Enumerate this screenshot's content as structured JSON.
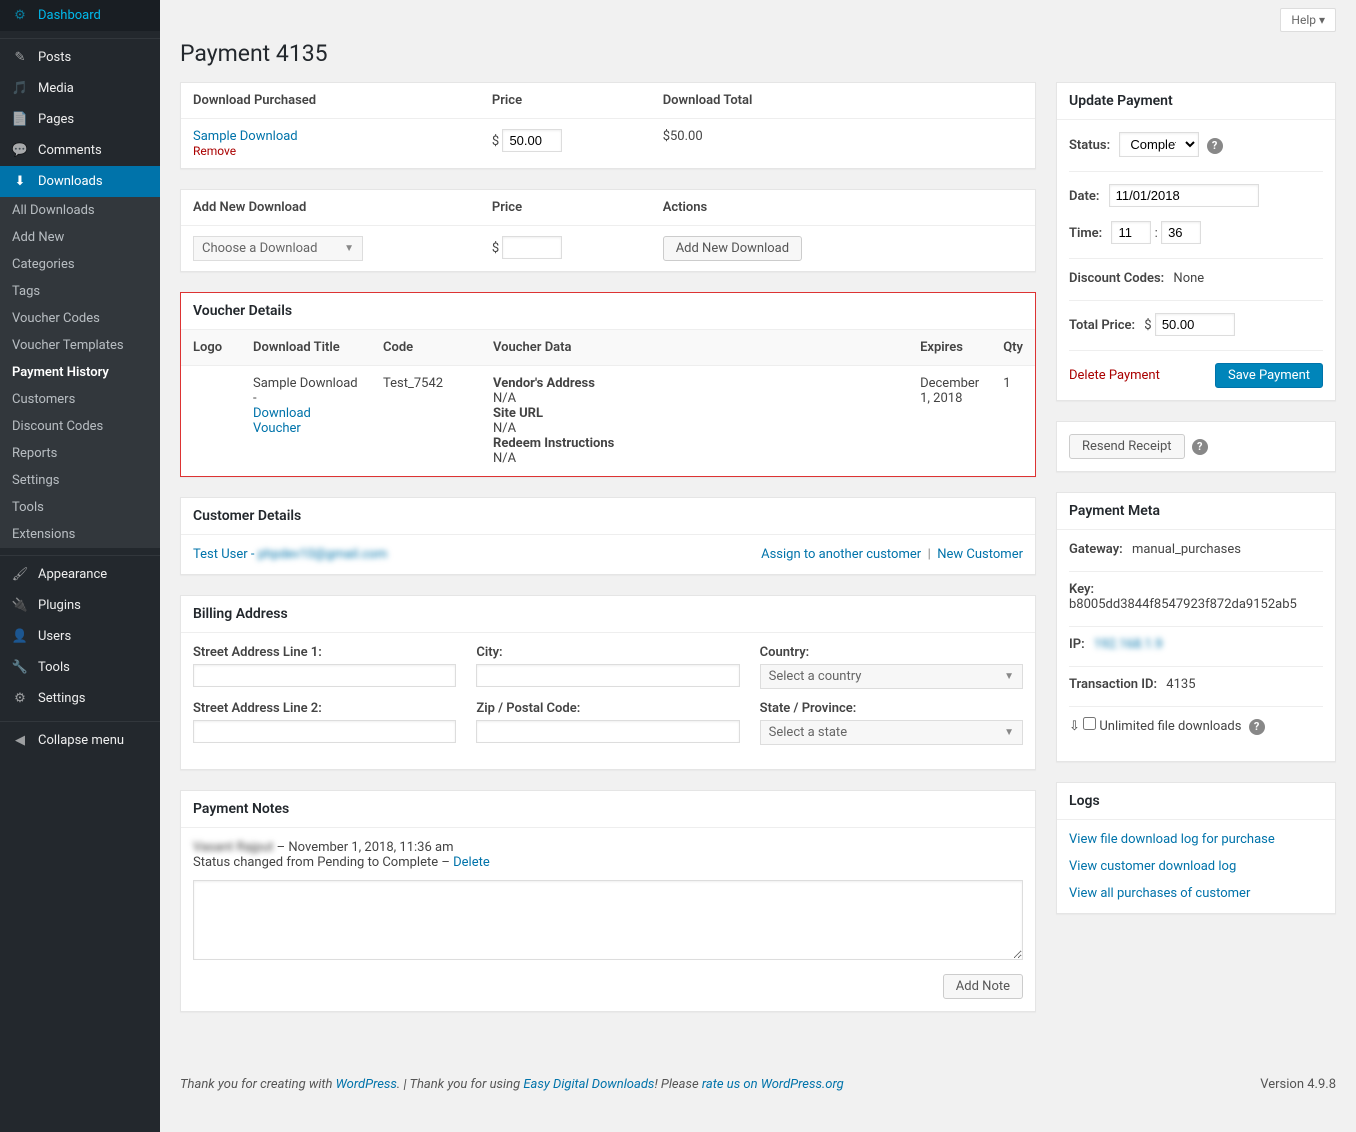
{
  "topbar": {
    "help": "Help"
  },
  "page_title": "Payment 4135",
  "sidebar": {
    "main": [
      {
        "icon": "⚙",
        "label": "Dashboard"
      },
      {
        "icon": "✎",
        "label": "Posts"
      },
      {
        "icon": "🎵",
        "label": "Media"
      },
      {
        "icon": "📄",
        "label": "Pages"
      },
      {
        "icon": "💬",
        "label": "Comments"
      }
    ],
    "downloads_label": "Downloads",
    "downloads_icon": "⬇",
    "submenu": [
      "All Downloads",
      "Add New",
      "Categories",
      "Tags",
      "Voucher Codes",
      "Voucher Templates",
      "Payment History",
      "Customers",
      "Discount Codes",
      "Reports",
      "Settings",
      "Tools",
      "Extensions"
    ],
    "bottom": [
      {
        "icon": "🖌",
        "label": "Appearance"
      },
      {
        "icon": "🔌",
        "label": "Plugins"
      },
      {
        "icon": "👤",
        "label": "Users"
      },
      {
        "icon": "🔧",
        "label": "Tools"
      },
      {
        "icon": "⚙",
        "label": "Settings"
      }
    ],
    "collapse": "Collapse menu"
  },
  "purchased": {
    "headers": [
      "Download Purchased",
      "Price",
      "Download Total"
    ],
    "item_name": "Sample Download",
    "remove": "Remove",
    "price_value": "50.00",
    "total": "$50.00"
  },
  "add_download": {
    "headers": [
      "Add New Download",
      "Price",
      "Actions"
    ],
    "choose_placeholder": "Choose a Download",
    "add_button": "Add New Download"
  },
  "voucher": {
    "title": "Voucher Details",
    "headers": [
      "Logo",
      "Download Title",
      "Code",
      "Voucher Data",
      "Expires",
      "Qty"
    ],
    "download_title_prefix": "Sample Download -",
    "download_voucher_link": "Download Voucher",
    "code": "Test_7542",
    "vendor_label": "Vendor's Address",
    "vendor_value": "N/A",
    "site_label": "Site URL",
    "site_value": "N/A",
    "redeem_label": "Redeem Instructions",
    "redeem_value": "N/A",
    "expires": "December 1, 2018",
    "qty": "1"
  },
  "customer": {
    "title": "Customer Details",
    "user_name": "Test User - ",
    "user_email": "phpdev10@gmail.com",
    "assign": "Assign to another customer",
    "new": "New Customer"
  },
  "billing": {
    "title": "Billing Address",
    "street1": "Street Address Line 1:",
    "street2": "Street Address Line 2:",
    "city": "City:",
    "zip": "Zip / Postal Code:",
    "country": "Country:",
    "country_placeholder": "Select a country",
    "state": "State / Province:",
    "state_placeholder": "Select a state"
  },
  "notes": {
    "title": "Payment Notes",
    "author": "Vasant Rajput",
    "meta": " – November 1, 2018, 11:36 am",
    "text": "Status changed from Pending to Complete – ",
    "delete": "Delete",
    "add_button": "Add Note"
  },
  "update": {
    "title": "Update Payment",
    "status_label": "Status:",
    "status_value": "Complete",
    "date_label": "Date:",
    "date_value": "11/01/2018",
    "time_label": "Time:",
    "time_h": "11",
    "time_m": "36",
    "discount_label": "Discount Codes:",
    "discount_value": "None",
    "total_label": "Total Price:",
    "total_value": "50.00",
    "delete": "Delete Payment",
    "save": "Save Payment",
    "resend": "Resend Receipt"
  },
  "meta": {
    "title": "Payment Meta",
    "gateway_label": "Gateway:",
    "gateway_value": "manual_purchases",
    "key_label": "Key:",
    "key_value": "b8005dd3844f8547923f872da9152ab5",
    "ip_label": "IP:",
    "ip_value": "192.168.1.9",
    "txn_label": "Transaction ID:",
    "txn_value": "4135",
    "unlimited": "Unlimited file downloads"
  },
  "logs": {
    "title": "Logs",
    "links": [
      "View file download log for purchase",
      "View customer download log",
      "View all purchases of customer"
    ]
  },
  "footer": {
    "thanks_prefix": "Thank you for creating with ",
    "wp": "WordPress",
    "thanks_mid": ". | Thank you for using ",
    "edd": "Easy Digital Downloads",
    "thanks_suffix": "! Please ",
    "rate": "rate us on WordPress.org",
    "version": "Version 4.9.8"
  }
}
